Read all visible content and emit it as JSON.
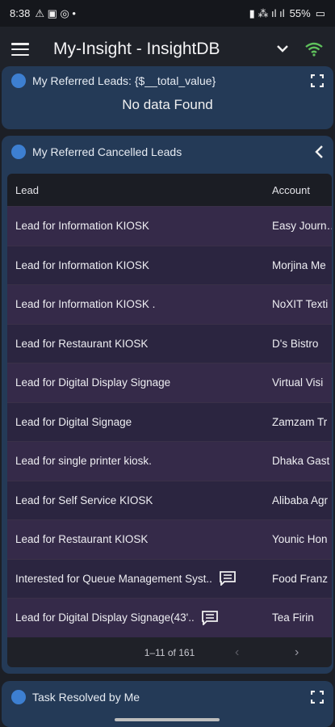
{
  "status": {
    "time": "8:38",
    "battery": "55%"
  },
  "appbar": {
    "title": "My-Insight - InsightDB"
  },
  "card1": {
    "title": "My Referred Leads: {$__total_value}",
    "empty_text": "No data Found"
  },
  "card2": {
    "title": "My Referred Cancelled Leads",
    "columns": {
      "lead": "Lead",
      "account": "Account"
    },
    "rows": [
      {
        "lead": "Lead for Information KIOSK",
        "account": "Easy Journ…"
      },
      {
        "lead": "Lead for Information KIOSK",
        "account": "Morjina Me"
      },
      {
        "lead": "Lead for Information KIOSK .",
        "account": "NoXIT Texti"
      },
      {
        "lead": "Lead for Restaurant KIOSK",
        "account": "D's Bistro"
      },
      {
        "lead": "Lead for Digital Display Signage",
        "account": "Virtual Visi"
      },
      {
        "lead": "Lead for Digital Signage",
        "account": "Zamzam Tr"
      },
      {
        "lead": "Lead for single printer kiosk.",
        "account": "Dhaka Gast"
      },
      {
        "lead": "Lead for Self Service KIOSK",
        "account": "Alibaba Agr"
      },
      {
        "lead": "Lead for Restaurant KIOSK",
        "account": "Younic Hon"
      },
      {
        "lead": "Interested for Queue Management Syst..",
        "account": "Food Franz"
      },
      {
        "lead": "Lead for Digital Display Signage(43'..",
        "account": "Tea Firin"
      }
    ],
    "pagination": "1–11 of 161"
  },
  "card3": {
    "title": "Task Resolved by Me"
  }
}
